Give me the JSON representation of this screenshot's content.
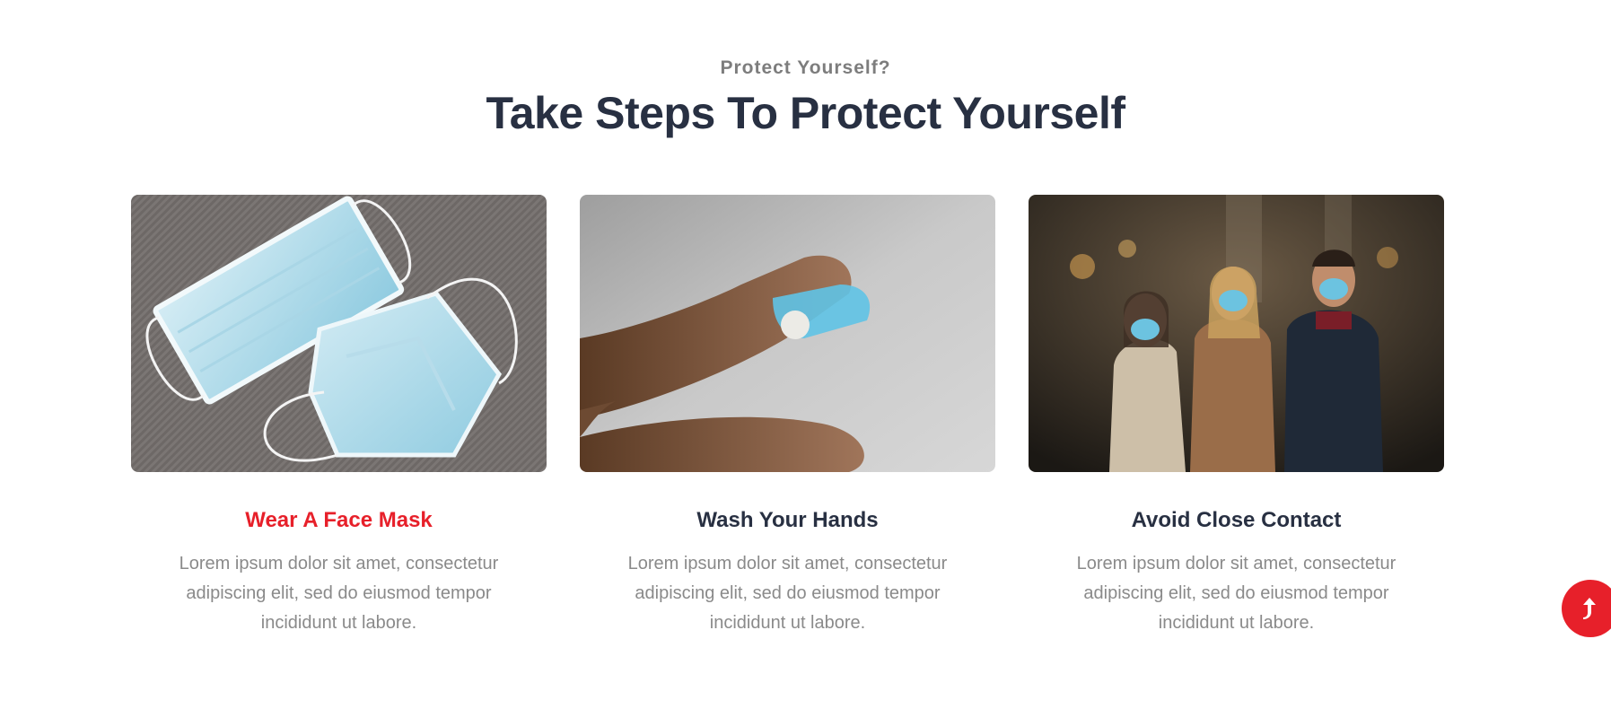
{
  "section": {
    "subtitle": "Protect Yourself?",
    "title": "Take Steps To Protect Yourself"
  },
  "cards": [
    {
      "image": "face-mask-photo",
      "title": "Wear A Face Mask",
      "text": "Lorem ipsum dolor sit amet, consectetur adipiscing elit, sed do eiusmod tempor incididunt ut labore."
    },
    {
      "image": "hand-sanitizer-photo",
      "title": "Wash Your Hands",
      "text": "Lorem ipsum dolor sit amet, consectetur adipiscing elit, sed do eiusmod tempor incididunt ut labore."
    },
    {
      "image": "people-wearing-masks-photo",
      "title": "Avoid Close Contact",
      "text": "Lorem ipsum dolor sit amet, consectetur adipiscing elit, sed do eiusmod tempor incididunt ut labore."
    }
  ],
  "scroll_top": {
    "icon": "arrow-up-icon"
  },
  "colors": {
    "accent": "#e7202a",
    "heading": "#283042",
    "muted": "#8a8a8a"
  }
}
